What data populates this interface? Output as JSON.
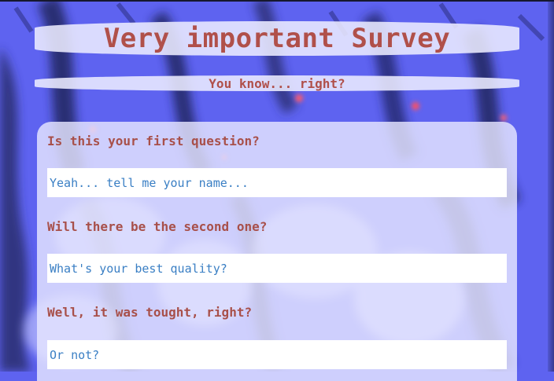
{
  "header": {
    "title": "Very important Survey",
    "subtitle": "You know... right?"
  },
  "questions": [
    {
      "label": "Is this your first question?",
      "placeholder": "Yeah... tell me your name..."
    },
    {
      "label": "Will there be the second one?",
      "placeholder": "What's your best quality?"
    },
    {
      "label": "Well, it was tought, right?",
      "placeholder": "Or not?"
    }
  ],
  "colors": {
    "background": "#5e63f0",
    "heading": "#b0504a",
    "answer_text": "#3a7fc4",
    "card": "#e6e6ff"
  }
}
